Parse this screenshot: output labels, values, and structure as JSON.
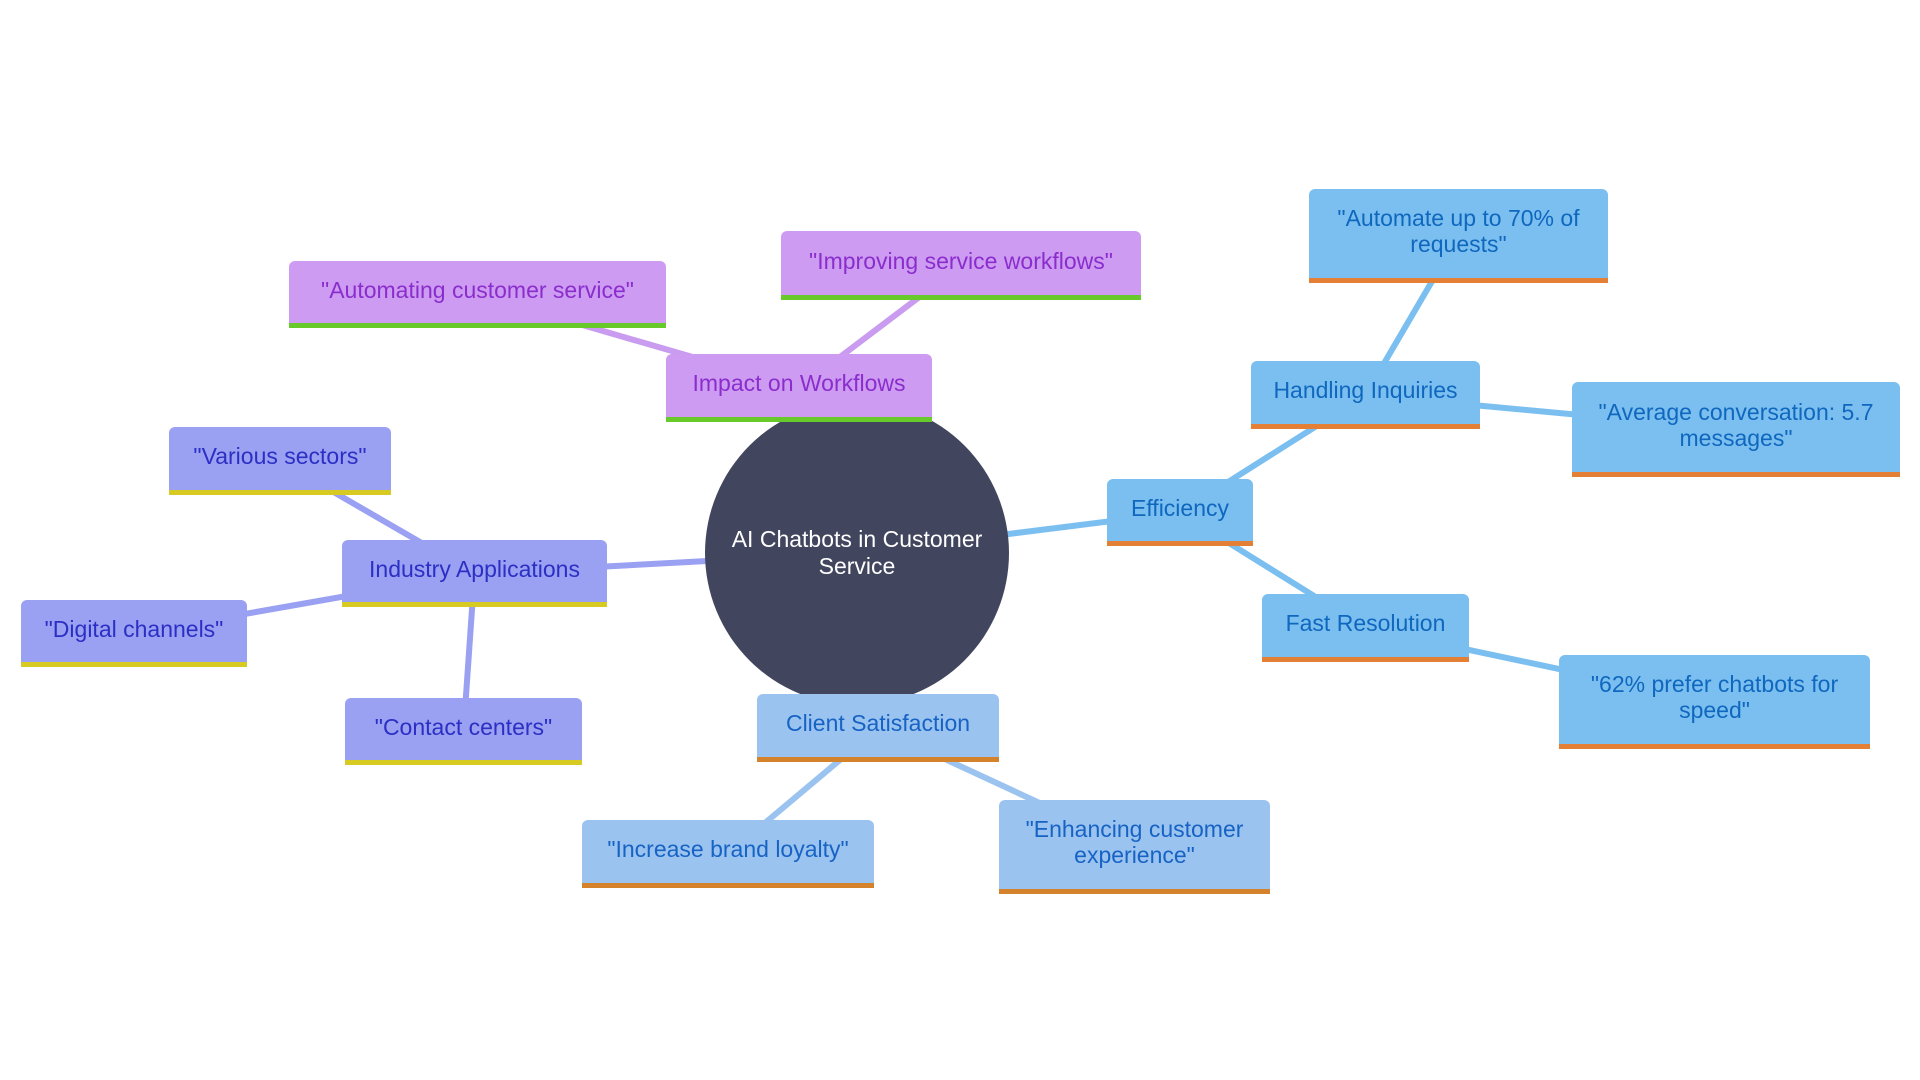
{
  "mindmap": {
    "root": {
      "label": "AI Chatbots in Customer Service",
      "color": "#41455e"
    },
    "branches": [
      {
        "id": "impact",
        "label": "Impact on Workflows",
        "theme": "purple",
        "line_color": "#c99cef",
        "children": [
          {
            "id": "improving",
            "label": "\"Improving service workflows\""
          },
          {
            "id": "automating",
            "label": "\"Automating customer service\""
          }
        ]
      },
      {
        "id": "industry",
        "label": "Industry Applications",
        "theme": "indigo",
        "line_color": "#9aa0f2",
        "children": [
          {
            "id": "sectors",
            "label": "\"Various sectors\""
          },
          {
            "id": "digital",
            "label": "\"Digital channels\""
          },
          {
            "id": "contact",
            "label": "\"Contact centers\""
          }
        ]
      },
      {
        "id": "satisfaction",
        "label": "Client Satisfaction",
        "theme": "lblue",
        "line_color": "#9bc3f0",
        "children": [
          {
            "id": "loyalty",
            "label": "\"Increase brand loyalty\""
          },
          {
            "id": "experience",
            "label": "\"Enhancing customer experience\""
          }
        ]
      },
      {
        "id": "efficiency",
        "label": "Efficiency",
        "theme": "blue",
        "line_color": "#7bbff0",
        "children": [
          {
            "id": "inquiries",
            "label": "Handling Inquiries",
            "children": [
              {
                "id": "automate70",
                "label": "\"Automate up to 70% of requests\""
              },
              {
                "id": "avgconv",
                "label": "\"Average conversation: 5.7 messages\""
              }
            ]
          },
          {
            "id": "fast",
            "label": "Fast Resolution",
            "children": [
              {
                "id": "prefer62",
                "label": "\"62% prefer chatbots for speed\""
              }
            ]
          }
        ]
      }
    ]
  },
  "colors": {
    "purple_fill": "#cd9cf2",
    "purple_text": "#8a2dcc",
    "purple_accent": "#67c92a",
    "indigo_fill": "#9aa0f2",
    "indigo_text": "#2b2fc4",
    "indigo_accent": "#d7ca23",
    "blue_fill": "#7bbff0",
    "blue_text": "#0f67be",
    "blue_accent": "#e47f36",
    "lightblue_fill": "#9bc3f0",
    "lightblue_text": "#1763c4",
    "lightblue_accent": "#d5822c"
  }
}
